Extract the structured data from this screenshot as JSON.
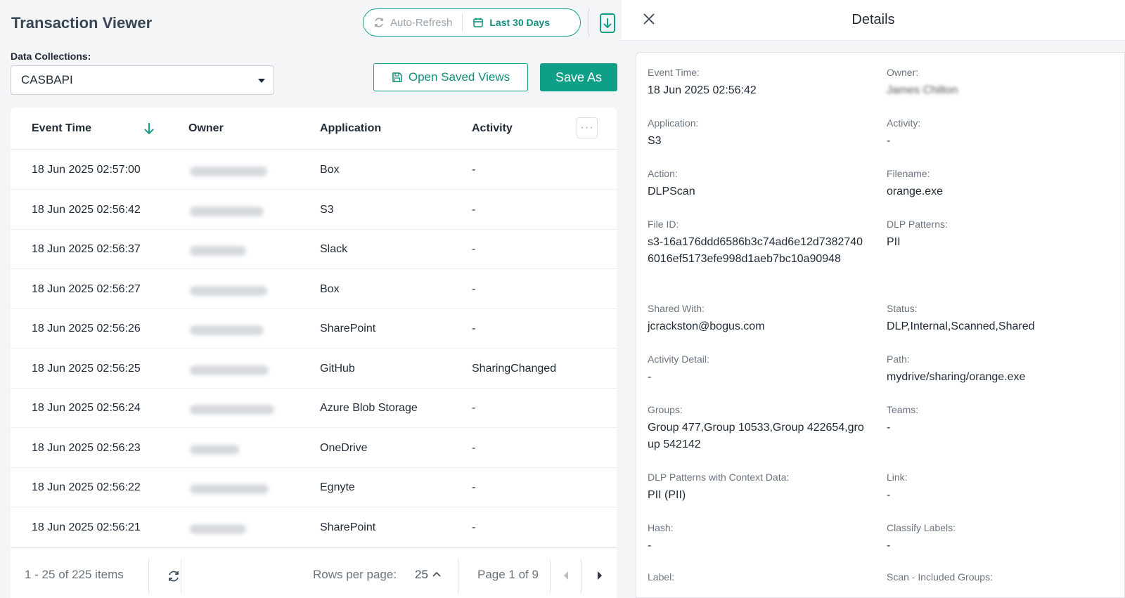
{
  "header": {
    "title": "Transaction Viewer",
    "auto_refresh_label": "Auto-Refresh",
    "date_range_label": "Last 30 Days"
  },
  "collections": {
    "label": "Data Collections:",
    "selected": "CASBAPI"
  },
  "actions": {
    "open_saved_views": "Open Saved Views",
    "save_as": "Save As"
  },
  "table": {
    "columns": [
      "Event Time",
      "Owner",
      "Application",
      "Activity"
    ],
    "rows": [
      {
        "event_time": "18 Jun 2025 02:57:00",
        "application": "Box",
        "activity": "-"
      },
      {
        "event_time": "18 Jun 2025 02:56:42",
        "application": "S3",
        "activity": "-"
      },
      {
        "event_time": "18 Jun 2025 02:56:37",
        "application": "Slack",
        "activity": "-"
      },
      {
        "event_time": "18 Jun 2025 02:56:27",
        "application": "Box",
        "activity": "-"
      },
      {
        "event_time": "18 Jun 2025 02:56:26",
        "application": "SharePoint",
        "activity": "-"
      },
      {
        "event_time": "18 Jun 2025 02:56:25",
        "application": "GitHub",
        "activity": "SharingChanged"
      },
      {
        "event_time": "18 Jun 2025 02:56:24",
        "application": "Azure Blob Storage",
        "activity": "-"
      },
      {
        "event_time": "18 Jun 2025 02:56:23",
        "application": "OneDrive",
        "activity": "-"
      },
      {
        "event_time": "18 Jun 2025 02:56:22",
        "application": "Egnyte",
        "activity": "-"
      },
      {
        "event_time": "18 Jun 2025 02:56:21",
        "application": "SharePoint",
        "activity": "-"
      }
    ]
  },
  "pager": {
    "item_count": "1 - 25 of 225 items",
    "rows_per_page_label": "Rows per page:",
    "rows_per_page_value": "25",
    "page_label": "Page 1 of 9"
  },
  "details": {
    "title": "Details",
    "fields": [
      {
        "label": "Event Time:",
        "value": "18 Jun 2025 02:56:42"
      },
      {
        "label": "Owner:",
        "value": "James Chilton"
      },
      {
        "label": "Application:",
        "value": "S3"
      },
      {
        "label": "Activity:",
        "value": "-"
      },
      {
        "label": "Action:",
        "value": "DLPScan"
      },
      {
        "label": "Filename:",
        "value": "orange.exe"
      },
      {
        "label": "File ID:",
        "value": "s3-16a176ddd6586b3c74ad6e12d73827406016ef5173efe998d1aeb7bc10a90948"
      },
      {
        "label": "DLP Patterns:",
        "value": "PII"
      },
      {
        "label": "Shared With:",
        "value": "jcrackston@bogus.com"
      },
      {
        "label": "Status:",
        "value": "DLP,Internal,Scanned,Shared"
      },
      {
        "label": "Activity Detail:",
        "value": "-"
      },
      {
        "label": "Path:",
        "value": "mydrive/sharing/orange.exe"
      },
      {
        "label": "Groups:",
        "value": "Group 477,Group 10533,Group 422654,group 542142"
      },
      {
        "label": "Teams:",
        "value": "-"
      },
      {
        "label": "DLP Patterns with Context Data:",
        "value": "PII (PII)"
      },
      {
        "label": "Link:",
        "value": "-"
      },
      {
        "label": "Hash:",
        "value": "-"
      },
      {
        "label": "Classify Labels:",
        "value": "-"
      },
      {
        "label": "Label:",
        "value": ""
      },
      {
        "label": "Scan - Included Groups:",
        "value": ""
      }
    ]
  }
}
